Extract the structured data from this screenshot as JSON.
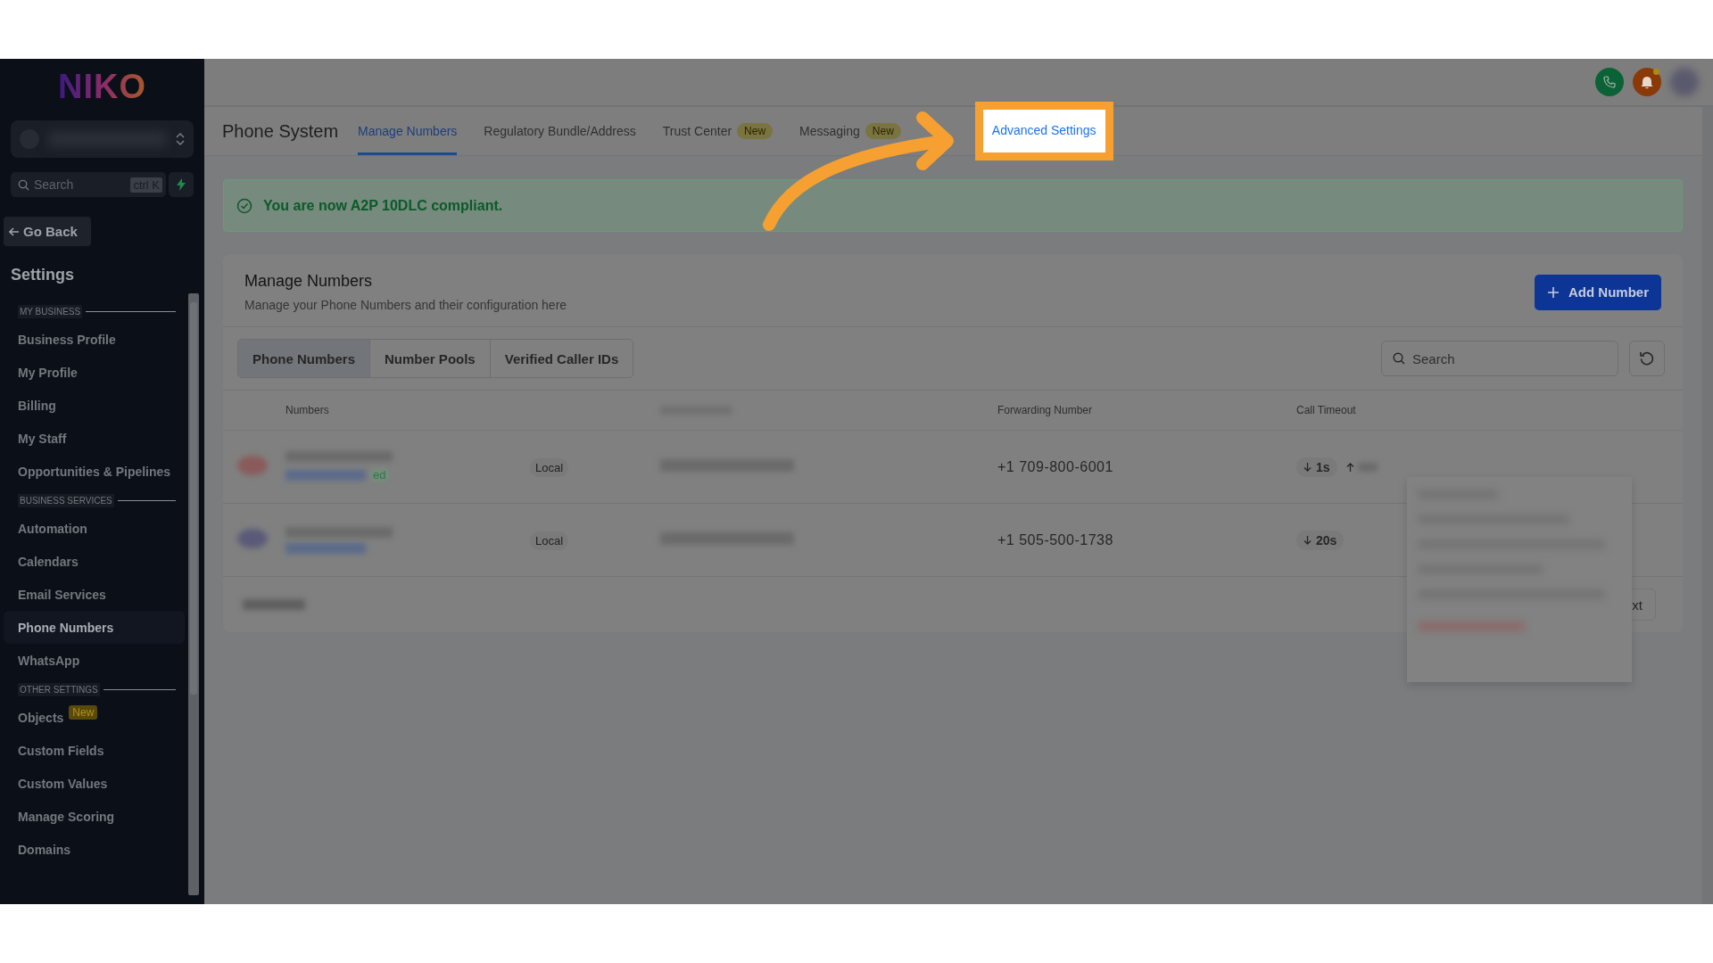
{
  "sidebar": {
    "logo": "NIKO",
    "search": {
      "placeholder": "Search",
      "shortcut": "ctrl K"
    },
    "go_back": "Go Back",
    "title": "Settings",
    "sections": [
      {
        "heading": "MY BUSINESS",
        "items": [
          {
            "label": "Business Profile",
            "selected": false
          },
          {
            "label": "My Profile",
            "selected": false
          },
          {
            "label": "Billing",
            "selected": false
          },
          {
            "label": "My Staff",
            "selected": false
          },
          {
            "label": "Opportunities & Pipelines",
            "selected": false
          }
        ]
      },
      {
        "heading": "BUSINESS SERVICES",
        "items": [
          {
            "label": "Automation",
            "selected": false
          },
          {
            "label": "Calendars",
            "selected": false
          },
          {
            "label": "Email Services",
            "selected": false
          },
          {
            "label": "Phone Numbers",
            "selected": true
          },
          {
            "label": "WhatsApp",
            "selected": false
          }
        ]
      },
      {
        "heading": "OTHER SETTINGS",
        "items": [
          {
            "label": "Objects",
            "selected": false,
            "badge": "New"
          },
          {
            "label": "Custom Fields",
            "selected": false
          },
          {
            "label": "Custom Values",
            "selected": false
          },
          {
            "label": "Manage Scoring",
            "selected": false
          },
          {
            "label": "Domains",
            "selected": false
          }
        ]
      }
    ]
  },
  "header": {
    "title": "Phone System",
    "tabs": [
      {
        "label": "Manage Numbers",
        "selected": true,
        "highlighted": false
      },
      {
        "label": "Regulatory Bundle/Address",
        "selected": false,
        "highlighted": false
      },
      {
        "label": "Trust Center",
        "selected": false,
        "highlighted": false,
        "badge": "New"
      },
      {
        "label": "Messaging",
        "selected": false,
        "highlighted": false,
        "badge": "New"
      },
      {
        "label": "Advanced Settings",
        "selected": false,
        "highlighted": true
      }
    ]
  },
  "alert": {
    "message": "You are now A2P 10DLC compliant."
  },
  "card": {
    "title": "Manage Numbers",
    "subtitle": "Manage your Phone Numbers and their configuration here",
    "add_button": "Add Number",
    "segments": [
      {
        "label": "Phone Numbers",
        "selected": true
      },
      {
        "label": "Number Pools",
        "selected": false
      },
      {
        "label": "Verified Caller IDs",
        "selected": false
      }
    ],
    "search": {
      "placeholder": "Search"
    },
    "table": {
      "columns": {
        "numbers": "Numbers",
        "forwarding": "Forwarding Number",
        "call_timeout": "Call Timeout"
      },
      "rows": [
        {
          "badge_fragment": "ed",
          "type": "Local",
          "forwarding_number": "+1 709-800-6001",
          "inbound_timeout": "1s",
          "outbound_timeout": true
        },
        {
          "type": "Local",
          "forwarding_number": "+1 505-500-1738",
          "inbound_timeout": "20s",
          "outbound_timeout": false
        }
      ]
    },
    "pagination": {
      "next_fragment": "xt"
    }
  }
}
